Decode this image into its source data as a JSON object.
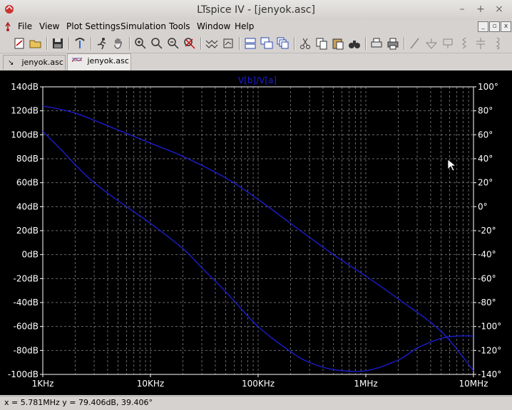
{
  "window": {
    "title": "LTspice IV - [jenyok.asc]"
  },
  "menu": [
    "File",
    "View",
    "Plot Settings",
    "Simulation",
    "Tools",
    "Window",
    "Help"
  ],
  "tabs": [
    {
      "label": "jenyok.asc",
      "active": false
    },
    {
      "label": "jenyok.asc",
      "active": true
    }
  ],
  "status": {
    "text": "x = 5.781MHz    y = 79.406dB, 39.406°"
  },
  "chart_data": {
    "type": "line",
    "title": "V[b]/V[a]",
    "x_scale": "log",
    "xlim_hz": [
      1000,
      10000000
    ],
    "x_ticks": [
      "1KHz",
      "10KHz",
      "100KHz",
      "1MHz",
      "10MHz"
    ],
    "y_left_label_unit": "dB",
    "ylim_left_db": [
      -100,
      140
    ],
    "y_left_ticks": [
      "140dB",
      "120dB",
      "100dB",
      "80dB",
      "60dB",
      "40dB",
      "20dB",
      "0dB",
      "-20dB",
      "-40dB",
      "-60dB",
      "-80dB",
      "-100dB"
    ],
    "ylim_right_deg": [
      -140,
      100
    ],
    "y_right_ticks": [
      "100°",
      "80°",
      "60°",
      "40°",
      "20°",
      "0°",
      "-20°",
      "-40°",
      "-60°",
      "-80°",
      "-100°",
      "-120°",
      "-140°"
    ],
    "grid": true,
    "colors": {
      "background": "#000000",
      "trace": "#1e1edc",
      "axis": "#ffffff",
      "grid": "#6a6a6a",
      "title": "#1e1edc"
    },
    "series": [
      {
        "axis": "left",
        "unit": "dB",
        "x": [
          1000,
          2000,
          5000,
          10000,
          20000,
          50000,
          100000,
          200000,
          500000,
          1000000,
          2000000,
          5000000,
          10000000
        ],
        "values": [
          124,
          118,
          104,
          93,
          82,
          64,
          46,
          26,
          0,
          -18,
          -37,
          -64,
          -97
        ]
      },
      {
        "axis": "right",
        "unit": "deg",
        "x": [
          1000,
          1500,
          2000,
          3000,
          5000,
          10000,
          20000,
          30000,
          50000,
          100000,
          200000,
          300000,
          500000,
          1000000,
          2000000,
          3000000,
          5000000,
          7000000,
          10000000
        ],
        "values": [
          63,
          47,
          35,
          20,
          5,
          -14,
          -35,
          -51,
          -71,
          -100,
          -121,
          -130,
          -136,
          -137,
          -128,
          -118,
          -110,
          -108,
          -108
        ]
      }
    ]
  }
}
